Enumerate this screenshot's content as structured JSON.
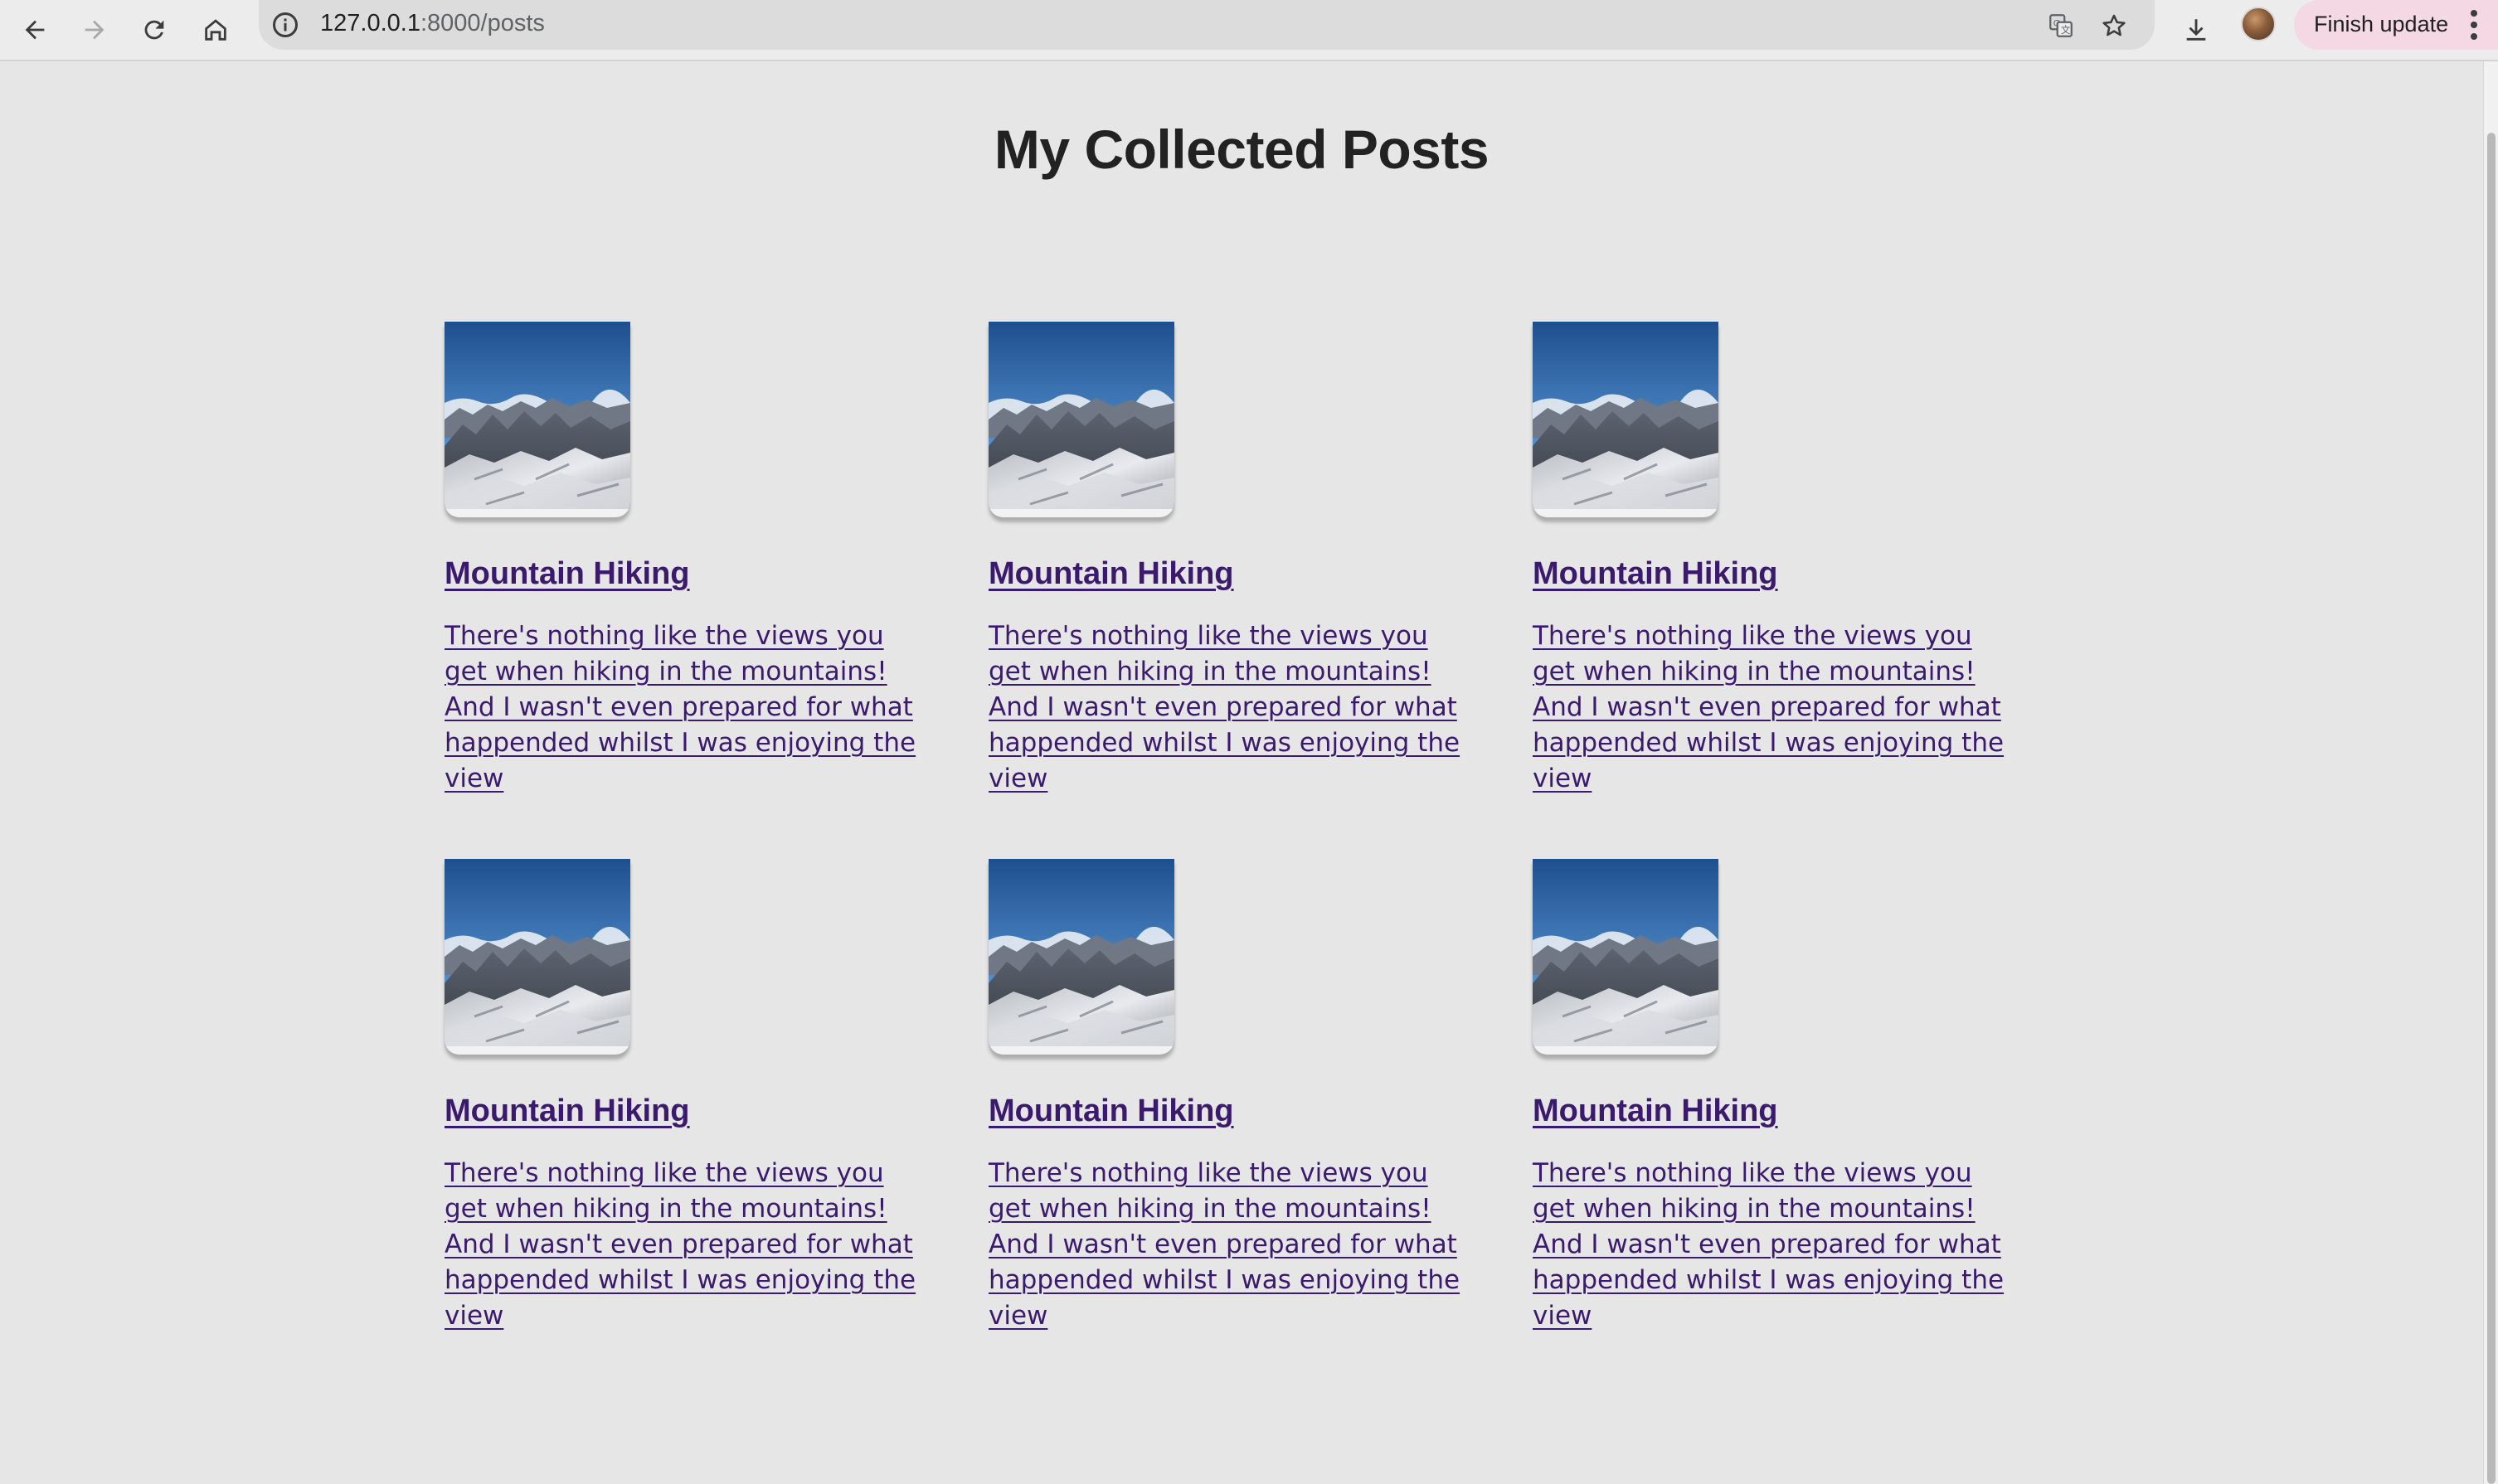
{
  "browser": {
    "url_host": "127.0.0.1",
    "url_path": ":8000/posts",
    "finish_update_label": "Finish update",
    "icons": {
      "back": "back-arrow-icon",
      "forward": "forward-arrow-icon",
      "reload": "reload-icon",
      "home": "home-icon",
      "site_info": "info-icon",
      "translate": "translate-icon",
      "bookmark": "star-icon",
      "downloads": "download-icon",
      "profile": "avatar",
      "menu": "kebab-menu-icon"
    }
  },
  "page": {
    "title": "My Collected Posts",
    "background": "#e6e6e6",
    "link_color": "#3b1a6e"
  },
  "posts": [
    {
      "title": "Mountain Hiking",
      "description": "There's nothing like the views you get when hiking in the mountains! And I wasn't even prepared for what happended whilst I was enjoying the view",
      "image": "mountain-photo"
    },
    {
      "title": "Mountain Hiking",
      "description": "There's nothing like the views you get when hiking in the mountains! And I wasn't even prepared for what happended whilst I was enjoying the view",
      "image": "mountain-photo"
    },
    {
      "title": "Mountain Hiking",
      "description": "There's nothing like the views you get when hiking in the mountains! And I wasn't even prepared for what happended whilst I was enjoying the view",
      "image": "mountain-photo"
    },
    {
      "title": "Mountain Hiking",
      "description": "There's nothing like the views you get when hiking in the mountains! And I wasn't even prepared for what happended whilst I was enjoying the view",
      "image": "mountain-photo"
    },
    {
      "title": "Mountain Hiking",
      "description": "There's nothing like the views you get when hiking in the mountains! And I wasn't even prepared for what happended whilst I was enjoying the view",
      "image": "mountain-photo"
    },
    {
      "title": "Mountain Hiking",
      "description": "There's nothing like the views you get when hiking in the mountains! And I wasn't even prepared for what happended whilst I was enjoying the view",
      "image": "mountain-photo"
    }
  ]
}
